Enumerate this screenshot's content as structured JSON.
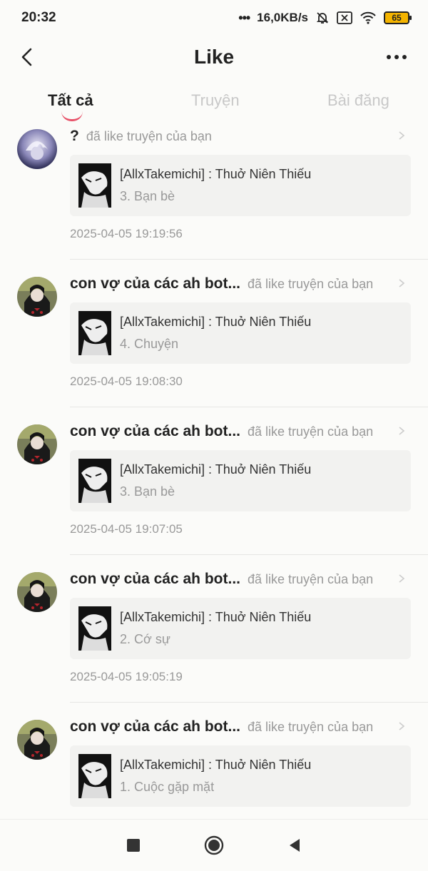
{
  "status_bar": {
    "time": "20:32",
    "network_speed": "16,0KB/s",
    "battery_level": "65",
    "icons": [
      "signal-dots-icon",
      "mute-bell-icon",
      "sim-x-icon",
      "wifi-icon",
      "battery-icon"
    ]
  },
  "header": {
    "title": "Like",
    "back_icon": "chevron-left-icon",
    "more_icon": "more-dots-icon"
  },
  "tabs": [
    {
      "label": "Tất cả",
      "active": true
    },
    {
      "label": "Truyện",
      "active": false
    },
    {
      "label": "Bài đăng",
      "active": false
    }
  ],
  "accent_color": "#e8536a",
  "notifications": [
    {
      "user": "?",
      "action": "đã like truyện của bạn",
      "story_title": "[AllxTakemichi] : Thuở Niên Thiếu",
      "chapter": "3. Bạn bè",
      "timestamp": "2025-04-05 19:19:56"
    },
    {
      "user": "con vợ của các ah bot...",
      "action": "đã like truyện của bạn",
      "story_title": "[AllxTakemichi] : Thuở Niên Thiếu",
      "chapter": "4. Chuyện",
      "timestamp": "2025-04-05 19:08:30"
    },
    {
      "user": "con vợ của các ah bot...",
      "action": "đã like truyện của bạn",
      "story_title": "[AllxTakemichi] : Thuở Niên Thiếu",
      "chapter": "3. Bạn bè",
      "timestamp": "2025-04-05 19:07:05"
    },
    {
      "user": "con vợ của các ah bot...",
      "action": "đã like truyện của bạn",
      "story_title": "[AllxTakemichi] : Thuở Niên Thiếu",
      "chapter": "2. Cớ sự",
      "timestamp": "2025-04-05 19:05:19"
    },
    {
      "user": "con vợ của các ah bot...",
      "action": "đã like truyện của bạn",
      "story_title": "[AllxTakemichi] : Thuở Niên Thiếu",
      "chapter": "1. Cuộc gặp mặt",
      "timestamp": ""
    }
  ],
  "nav_bar": {
    "icons": [
      "recent-apps-square-icon",
      "home-circle-icon",
      "back-triangle-icon"
    ]
  }
}
